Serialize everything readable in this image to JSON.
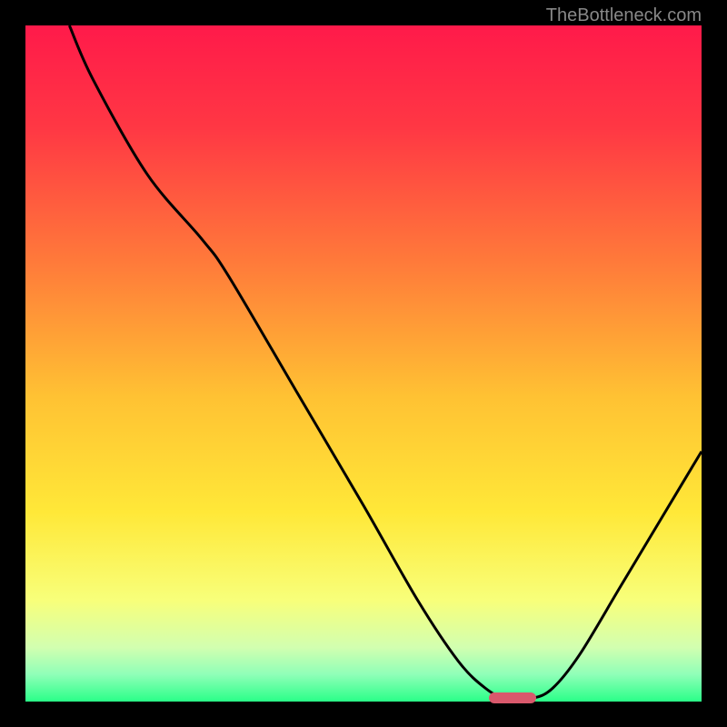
{
  "watermark": "TheBottleneck.com",
  "chart_data": {
    "type": "line",
    "title": "",
    "xlabel": "",
    "ylabel": "",
    "xlim": [
      0,
      100
    ],
    "ylim": [
      0,
      100
    ],
    "gradient_stops": [
      {
        "offset": 0,
        "color": "#ff1a4a"
      },
      {
        "offset": 15,
        "color": "#ff3744"
      },
      {
        "offset": 35,
        "color": "#ff7a3a"
      },
      {
        "offset": 55,
        "color": "#ffc233"
      },
      {
        "offset": 72,
        "color": "#ffe838"
      },
      {
        "offset": 85,
        "color": "#f8ff7a"
      },
      {
        "offset": 92,
        "color": "#d2ffb0"
      },
      {
        "offset": 96,
        "color": "#8fffb8"
      },
      {
        "offset": 100,
        "color": "#2aff88"
      }
    ],
    "series": [
      {
        "name": "bottleneck-curve",
        "points": [
          {
            "x": 6.5,
            "y": 100
          },
          {
            "x": 10,
            "y": 92
          },
          {
            "x": 18,
            "y": 78
          },
          {
            "x": 26,
            "y": 68.5
          },
          {
            "x": 30,
            "y": 63
          },
          {
            "x": 40,
            "y": 46
          },
          {
            "x": 50,
            "y": 29
          },
          {
            "x": 58,
            "y": 15
          },
          {
            "x": 64,
            "y": 6
          },
          {
            "x": 68,
            "y": 2
          },
          {
            "x": 71,
            "y": 0.5
          },
          {
            "x": 75,
            "y": 0.5
          },
          {
            "x": 78,
            "y": 2
          },
          {
            "x": 82,
            "y": 7
          },
          {
            "x": 88,
            "y": 17
          },
          {
            "x": 94,
            "y": 27
          },
          {
            "x": 100,
            "y": 37
          }
        ]
      }
    ],
    "marker": {
      "x_center": 72,
      "width": 7,
      "y": 0.5,
      "color": "#d9596c"
    }
  }
}
